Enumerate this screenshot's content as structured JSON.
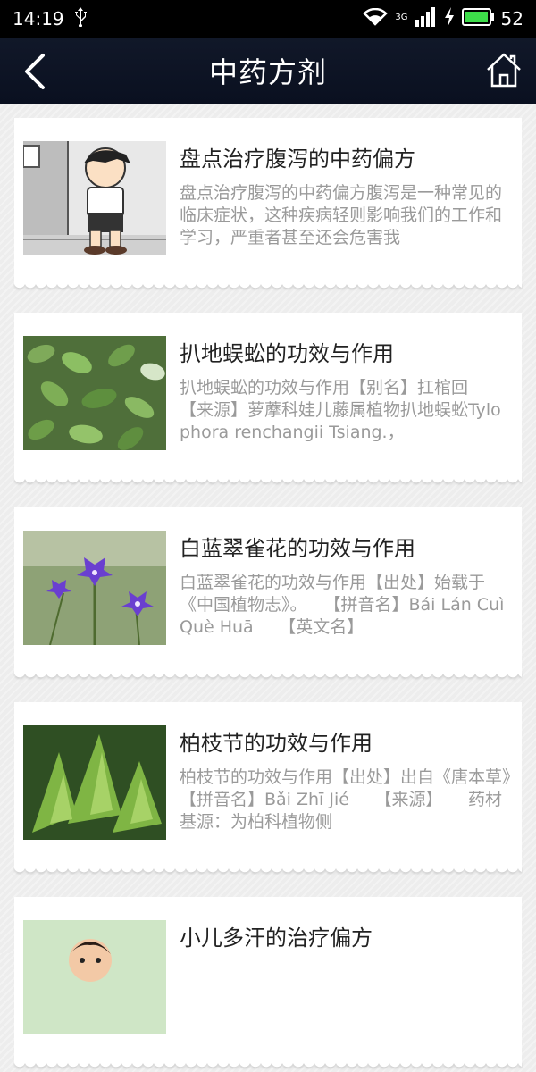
{
  "status_bar": {
    "time": "14:19",
    "network": "3G",
    "battery": "52",
    "icons": [
      "usb-icon",
      "wifi-icon",
      "signal-icon",
      "charging-icon",
      "battery-icon"
    ]
  },
  "nav": {
    "title": "中药方剂",
    "back_icon": "chevron-left-icon",
    "home_icon": "home-icon"
  },
  "articles": [
    {
      "title": "盘点治疗腹泻的中药偏方",
      "summary": "盘点治疗腹泻的中药偏方腹泻是一种常见的临床症状，这种疾病轻则影响我们的工作和学习，严重者甚至还会危害我",
      "thumb": "cartoon-boy-stomachache-image"
    },
    {
      "title": "扒地蜈蚣的功效与作用",
      "summary": "扒地蜈蚣的功效与作用【别名】扛棺回　　【来源】萝藦科娃儿藤属植物扒地蜈蚣Tylophora renchangii Tsiang.，",
      "thumb": "green-leaves-plant-image"
    },
    {
      "title": "白蓝翠雀花的功效与作用",
      "summary": "白蓝翠雀花的功效与作用【出处】始载于《中国植物志》。　　【拼音名】Bái Lán Cuì Què Huā　　【英文名】",
      "thumb": "purple-flower-image"
    },
    {
      "title": "柏枝节的功效与作用",
      "summary": "柏枝节的功效与作用【出处】出自《唐本草》　　【拼音名】Bǎi Zhī Jié　　【来源】　　药材基源：为柏科植物侧",
      "thumb": "cypress-branch-image"
    },
    {
      "title": "小儿多汗的治疗偏方",
      "summary": "",
      "thumb": "baby-photo-image"
    }
  ]
}
